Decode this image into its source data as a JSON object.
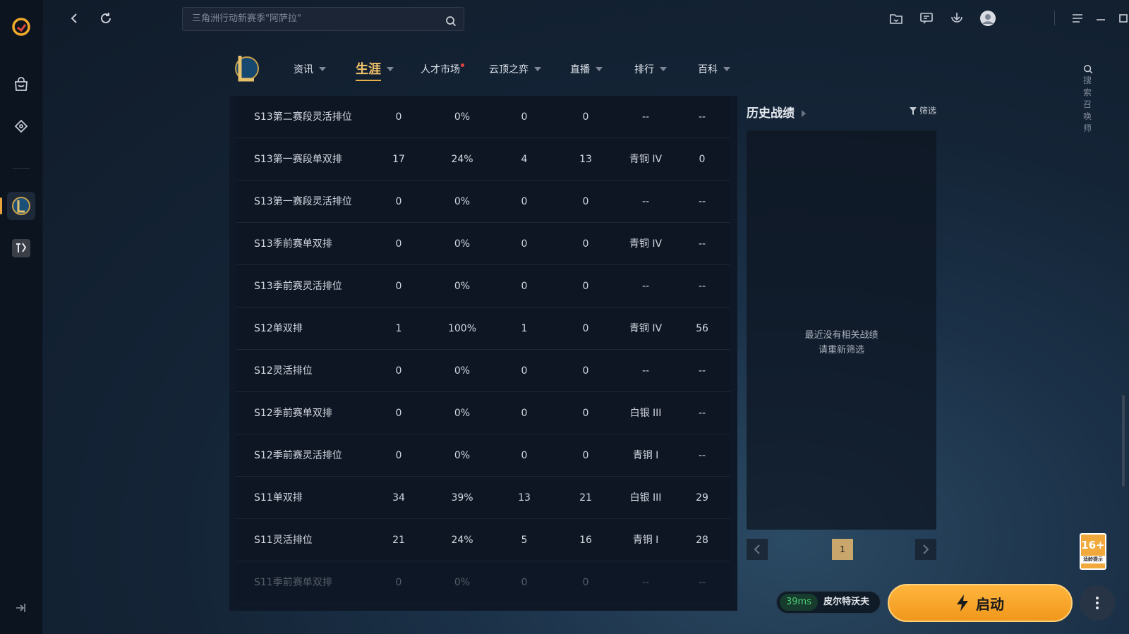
{
  "app": {
    "search_placeholder": "三角洲行动新赛季\"阿萨拉\"",
    "sidebar_icons": [
      "wegame-logo-icon",
      "store-icon",
      "game-pad-icon",
      "lol-game-icon",
      "other-game-icon"
    ]
  },
  "nav": {
    "items": [
      {
        "label": "资讯",
        "caret": true
      },
      {
        "label": "生涯",
        "caret": true,
        "active": true
      },
      {
        "label": "人才市场",
        "dot": true
      },
      {
        "label": "云顶之弈",
        "caret": true
      },
      {
        "label": "直播",
        "caret": true
      },
      {
        "label": "排行",
        "caret": true
      },
      {
        "label": "百科",
        "caret": true
      }
    ],
    "summoner_search_placeholder": "搜索召唤师"
  },
  "stats_table": {
    "rows": [
      [
        "S13第二赛段灵活排位",
        "0",
        "0%",
        "0",
        "0",
        "--",
        "--"
      ],
      [
        "S13第一赛段单双排",
        "17",
        "24%",
        "4",
        "13",
        "青铜 IV",
        "0"
      ],
      [
        "S13第一赛段灵活排位",
        "0",
        "0%",
        "0",
        "0",
        "--",
        "--"
      ],
      [
        "S13季前赛单双排",
        "0",
        "0%",
        "0",
        "0",
        "青铜 IV",
        "--"
      ],
      [
        "S13季前赛灵活排位",
        "0",
        "0%",
        "0",
        "0",
        "--",
        "--"
      ],
      [
        "S12单双排",
        "1",
        "100%",
        "1",
        "0",
        "青铜 IV",
        "56"
      ],
      [
        "S12灵活排位",
        "0",
        "0%",
        "0",
        "0",
        "--",
        "--"
      ],
      [
        "S12季前赛单双排",
        "0",
        "0%",
        "0",
        "0",
        "白银 III",
        "--"
      ],
      [
        "S12季前赛灵活排位",
        "0",
        "0%",
        "0",
        "0",
        "青铜 I",
        "--"
      ],
      [
        "S11单双排",
        "34",
        "39%",
        "13",
        "21",
        "白银 III",
        "29"
      ],
      [
        "S11灵活排位",
        "21",
        "24%",
        "5",
        "16",
        "青铜 I",
        "28"
      ],
      [
        "S11季前赛单双排",
        "0",
        "0%",
        "0",
        "0",
        "--",
        "--"
      ]
    ]
  },
  "history": {
    "title": "历史战绩",
    "filter_label": "筛选",
    "empty_line1": "最近没有相关战绩",
    "empty_line2": "请重新筛选",
    "current_page": "1"
  },
  "footer": {
    "ping": "39ms",
    "server": "皮尔特沃夫",
    "launch_label": "启动",
    "age_rating": "16+",
    "age_note": "适龄提示"
  },
  "colors": {
    "accent": "#f0a82a",
    "active_tab": "#f0c26a",
    "ping_green": "#4cd07a"
  }
}
